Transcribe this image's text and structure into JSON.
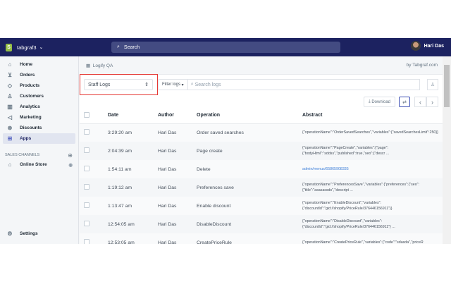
{
  "topbar": {
    "store_name": "tabgraf3",
    "search_placeholder": "Search",
    "user_name": "Hari Das"
  },
  "sidebar": {
    "items": [
      {
        "label": "Home",
        "icon": "home-icon",
        "glyph": "⌂"
      },
      {
        "label": "Orders",
        "icon": "orders-icon",
        "glyph": "⊻"
      },
      {
        "label": "Products",
        "icon": "tag-icon",
        "glyph": "◇"
      },
      {
        "label": "Customers",
        "icon": "person-icon",
        "glyph": "♙"
      },
      {
        "label": "Analytics",
        "icon": "bar-chart-icon",
        "glyph": "▥"
      },
      {
        "label": "Marketing",
        "icon": "megaphone-icon",
        "glyph": "◁"
      },
      {
        "label": "Discounts",
        "icon": "discount-icon",
        "glyph": "⊗"
      },
      {
        "label": "Apps",
        "icon": "apps-icon",
        "glyph": "⊞"
      }
    ],
    "sales_channels_label": "SALES CHANNELS",
    "online_store": "Online Store",
    "settings": "Settings"
  },
  "app": {
    "title": "Logify QA",
    "byline": "by Tabgraf.com",
    "log_type": "Staff Logs",
    "filter_label": "Filter logs",
    "search_placeholder": "Search logs",
    "download": "Download"
  },
  "table": {
    "headers": [
      "Date",
      "Author",
      "Operation",
      "Abstract"
    ],
    "rows": [
      {
        "date": "3:29:20 am",
        "author": "Hari Das",
        "operation": "Order saved searches",
        "abstract": "{\"operationName\":\"OrderSavedSearches\",\"variables\":{\"savedSearchesLimit\":250}}"
      },
      {
        "date": "2:04:39 am",
        "author": "Hari Das",
        "operation": "Page create",
        "abstract": "{\"operationName\":\"PageCreate\",\"variables\":{\"page\":{\"bodyHtml\":\"sddss\",\"published\":true,\"seo\":{\"descr ..."
      },
      {
        "date": "1:54:11 am",
        "author": "Hari Das",
        "operation": "Delete",
        "abstract": "admin/menus/65865908335",
        "link": true
      },
      {
        "date": "1:19:12 am",
        "author": "Hari Das",
        "operation": "Preferences save",
        "abstract": "{\"operationName\":\"PreferencesSave\",\"variables\":{\"preferences\":{\"seo\":{\"title\":\"asasassds\",\"descript ..."
      },
      {
        "date": "1:13:47 am",
        "author": "Hari Das",
        "operation": "Enable discount",
        "abstract": "{\"operationName\":\"EnableDiscount\",\"variables\":{\"discountId\":\"gid://shopify/PriceRule/376446156911\"}}"
      },
      {
        "date": "12:54:05 am",
        "author": "Hari Das",
        "operation": "DisableDiscount",
        "abstract": "{\"operationName\":\"DisableDiscount\",\"variables\":{\"discountId\":\"gid://shopify/PriceRule/376446156911\"} ..."
      },
      {
        "date": "12:53:05 am",
        "author": "Hari Das",
        "operation": "CreatePriceRule",
        "abstract": "{\"operationName\":\"CreatePriceRule\",\"variables\":{\"code\":\"sdasda\",\"priceR"
      }
    ]
  },
  "colors": {
    "topbar": "#1c2260",
    "highlight": "#e53935",
    "link": "#3b7dd8"
  }
}
